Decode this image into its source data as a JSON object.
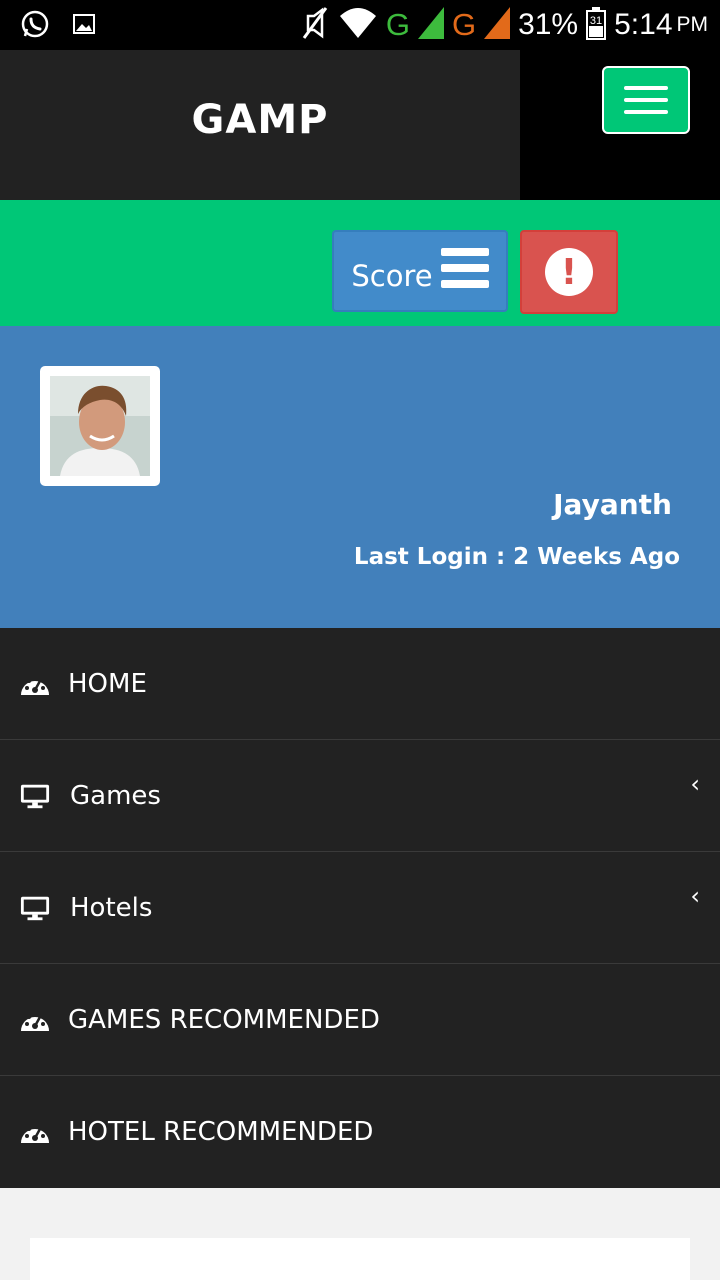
{
  "status_bar": {
    "network_1": "G",
    "network_2": "G",
    "battery": "31%",
    "time": "5:14",
    "ampm": "PM",
    "calendar_day": "31",
    "icons": [
      "whatsapp-icon",
      "image-icon",
      "mute-icon",
      "wifi-icon",
      "signal-icon",
      "battery-icon"
    ]
  },
  "header": {
    "brand": "GAMP",
    "menu_icon": "hamburger-icon"
  },
  "actions": {
    "score_label": "Score",
    "score_icon": "bars-icon",
    "alert_symbol": "!",
    "alert_icon": "exclamation-circle-icon"
  },
  "profile": {
    "name": "Jayanth",
    "last_login": "Last Login : 2 Weeks Ago"
  },
  "nav": {
    "items": [
      {
        "label": "HOME",
        "icon": "dashboard-icon",
        "has_submenu": false
      },
      {
        "label": "Games",
        "icon": "desktop-icon",
        "has_submenu": true
      },
      {
        "label": "Hotels",
        "icon": "desktop-icon",
        "has_submenu": true
      },
      {
        "label": "GAMES RECOMMENDED",
        "icon": "dashboard-icon",
        "has_submenu": false
      },
      {
        "label": "HOTEL RECOMMENDED",
        "icon": "dashboard-icon",
        "has_submenu": false
      }
    ],
    "chevron": "‹"
  },
  "colors": {
    "green": "#00c777",
    "blue": "#4280bb",
    "btn_blue": "#428bca",
    "red": "#d9534f",
    "dark": "#222222"
  }
}
